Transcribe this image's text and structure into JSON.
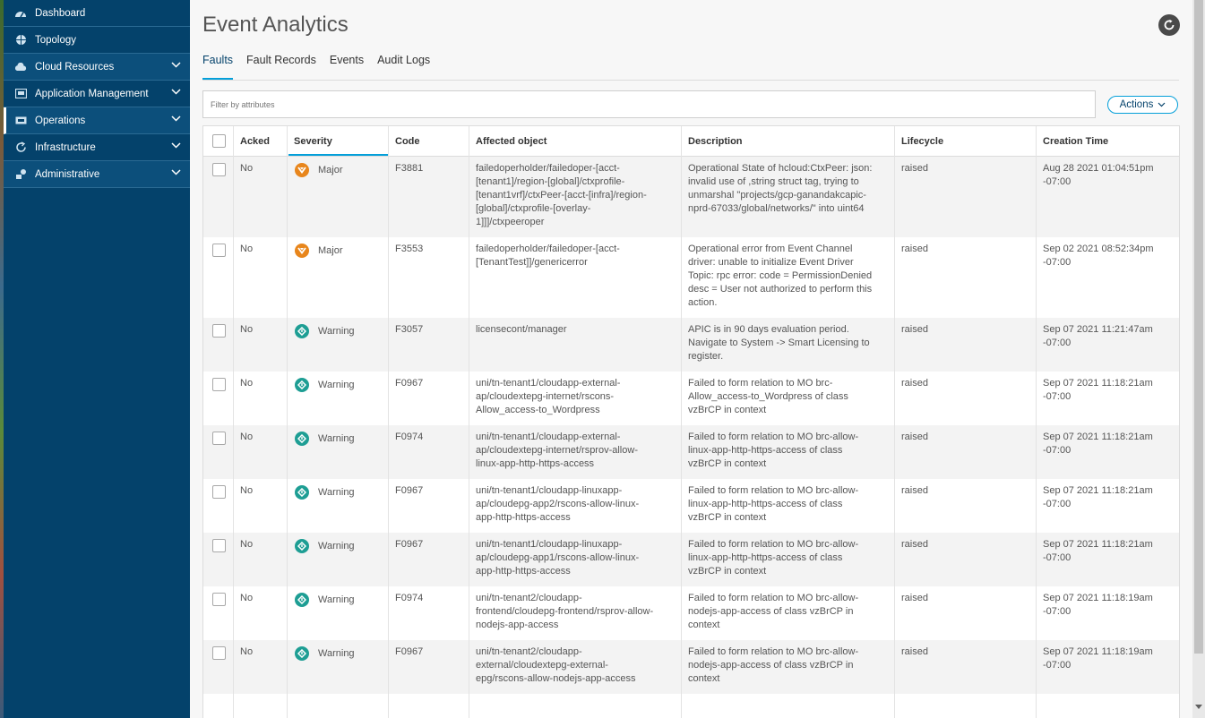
{
  "sidebar": {
    "items": [
      {
        "label": "Dashboard",
        "icon": "dashboard-icon",
        "expandable": false
      },
      {
        "label": "Topology",
        "icon": "topology-icon",
        "expandable": false
      },
      {
        "label": "Cloud Resources",
        "icon": "cloud-icon",
        "expandable": true
      },
      {
        "label": "Application Management",
        "icon": "application-icon",
        "expandable": true
      },
      {
        "label": "Operations",
        "icon": "operations-icon",
        "expandable": true,
        "active": true
      },
      {
        "label": "Infrastructure",
        "icon": "infrastructure-icon",
        "expandable": true
      },
      {
        "label": "Administrative",
        "icon": "administrative-icon",
        "expandable": true
      }
    ]
  },
  "header": {
    "title": "Event Analytics"
  },
  "tabs": [
    {
      "label": "Faults",
      "active": true
    },
    {
      "label": "Fault Records"
    },
    {
      "label": "Events"
    },
    {
      "label": "Audit Logs"
    }
  ],
  "filter": {
    "placeholder": "Filter by attributes"
  },
  "actions": {
    "label": "Actions"
  },
  "table": {
    "columns": [
      "Acked",
      "Severity",
      "Code",
      "Affected object",
      "Description",
      "Lifecycle",
      "Creation Time"
    ],
    "rows": [
      {
        "acked": "No",
        "severity": "Major",
        "code": "F3881",
        "object": [
          "failedoperholder/failedoper-[acct-",
          "[tenant1]/region-[global]/ctxprofile-",
          "[tenant1vrf]/ctxPeer-[acct-[infra]/region-",
          "[global]/ctxprofile-[overlay-",
          "1]]]/ctxpeeroper"
        ],
        "description": [
          "Operational State of hcloud:CtxPeer: json:",
          "invalid use of ,string struct tag, trying to",
          "unmarshal \"projects/gcp-ganandakcapic-",
          "nprd-67033/global/networks/\" into uint64"
        ],
        "lifecycle": "raised",
        "time": [
          "Aug 28 2021 01:04:51pm",
          "-07:00"
        ]
      },
      {
        "acked": "No",
        "severity": "Major",
        "code": "F3553",
        "object": [
          "failedoperholder/failedoper-[acct-",
          "[TenantTest]]/genericerror"
        ],
        "description": [
          "Operational error from Event Channel",
          "driver: unable to initialize Event Driver",
          "Topic: rpc error: code = PermissionDenied",
          "desc = User not authorized to perform this",
          "action."
        ],
        "lifecycle": "raised",
        "time": [
          "Sep 02 2021 08:52:34pm",
          "-07:00"
        ]
      },
      {
        "acked": "No",
        "severity": "Warning",
        "code": "F3057",
        "object": [
          "licensecont/manager"
        ],
        "description": [
          "APIC is in 90 days evaluation period.",
          "Navigate to System -> Smart Licensing to",
          "register."
        ],
        "lifecycle": "raised",
        "time": [
          "Sep 07 2021 11:21:47am",
          "-07:00"
        ]
      },
      {
        "acked": "No",
        "severity": "Warning",
        "code": "F0967",
        "object": [
          "uni/tn-tenant1/cloudapp-external-",
          "ap/cloudextepg-internet/rscons-",
          "Allow_access-to_Wordpress"
        ],
        "description": [
          "Failed to form relation to MO brc-",
          "Allow_access-to_Wordpress of class",
          "vzBrCP in context"
        ],
        "lifecycle": "raised",
        "time": [
          "Sep 07 2021 11:18:21am",
          "-07:00"
        ]
      },
      {
        "acked": "No",
        "severity": "Warning",
        "code": "F0974",
        "object": [
          "uni/tn-tenant1/cloudapp-external-",
          "ap/cloudextepg-internet/rsprov-allow-",
          "linux-app-http-https-access"
        ],
        "description": [
          "Failed to form relation to MO brc-allow-",
          "linux-app-http-https-access of class",
          "vzBrCP in context"
        ],
        "lifecycle": "raised",
        "time": [
          "Sep 07 2021 11:18:21am",
          "-07:00"
        ]
      },
      {
        "acked": "No",
        "severity": "Warning",
        "code": "F0967",
        "object": [
          "uni/tn-tenant1/cloudapp-linuxapp-",
          "ap/cloudepg-app2/rscons-allow-linux-",
          "app-http-https-access"
        ],
        "description": [
          "Failed to form relation to MO brc-allow-",
          "linux-app-http-https-access of class",
          "vzBrCP in context"
        ],
        "lifecycle": "raised",
        "time": [
          "Sep 07 2021 11:18:21am",
          "-07:00"
        ]
      },
      {
        "acked": "No",
        "severity": "Warning",
        "code": "F0967",
        "object": [
          "uni/tn-tenant1/cloudapp-linuxapp-",
          "ap/cloudepg-app1/rscons-allow-linux-",
          "app-http-https-access"
        ],
        "description": [
          "Failed to form relation to MO brc-allow-",
          "linux-app-http-https-access of class",
          "vzBrCP in context"
        ],
        "lifecycle": "raised",
        "time": [
          "Sep 07 2021 11:18:21am",
          "-07:00"
        ]
      },
      {
        "acked": "No",
        "severity": "Warning",
        "code": "F0974",
        "object": [
          "uni/tn-tenant2/cloudapp-",
          "frontend/cloudepg-frontend/rsprov-allow-",
          "nodejs-app-access"
        ],
        "description": [
          "Failed to form relation to MO brc-allow-",
          "nodejs-app-access of class vzBrCP in",
          "context"
        ],
        "lifecycle": "raised",
        "time": [
          "Sep 07 2021 11:18:19am",
          "-07:00"
        ]
      },
      {
        "acked": "No",
        "severity": "Warning",
        "code": "F0967",
        "object": [
          "uni/tn-tenant2/cloudapp-",
          "external/cloudextepg-external-",
          "epg/rscons-allow-nodejs-app-access"
        ],
        "description": [
          "Failed to form relation to MO brc-allow-",
          "nodejs-app-access of class vzBrCP in",
          "context"
        ],
        "lifecycle": "raised",
        "time": [
          "Sep 07 2021 11:18:19am",
          "-07:00"
        ]
      }
    ]
  },
  "colors": {
    "sidebar_bg": "#04426b",
    "accent": "#049fd9",
    "major": "#e8861c",
    "warning": "#1e9e94"
  }
}
